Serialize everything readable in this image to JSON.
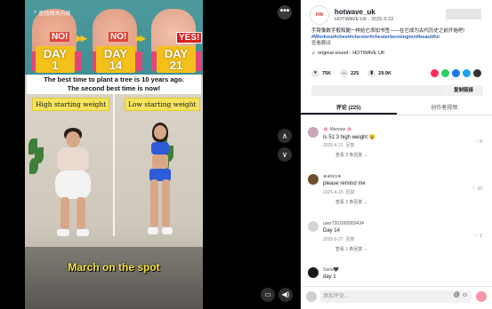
{
  "video": {
    "search_tag": "查找相关内容",
    "no_label": "NO!",
    "yes_label": "YES!",
    "days": [
      {
        "word": "DAY",
        "num": "1"
      },
      {
        "word": "DAY",
        "num": "14"
      },
      {
        "word": "DAY",
        "num": "21"
      }
    ],
    "quote_line1": "The best time to plant a tree is 10 years ago.",
    "quote_line2": "The second best time is now!",
    "label_left": "High starting weight",
    "label_right": "Low starting weight",
    "caption": "March on the spot"
  },
  "controls": {
    "more": "•••",
    "prev": "∧",
    "next": "∨"
  },
  "author": {
    "name": "hotwave_uk",
    "subtitle": "HOTWAVE UK · 2025-5-22",
    "desc": "手臂像数字般和腿一样给它添加书签——在它成为古代历史之前开始吧!",
    "tags": "#Workout#chest#chester#chesterbennington#beautiful",
    "translate": "查看翻译",
    "sound": "original sound - HOTWAVE UK"
  },
  "stats": {
    "likes": "75K",
    "comments": "225",
    "saves": "29.9K"
  },
  "share_colors": [
    "#fe2c55",
    "#25d366",
    "#1877f2",
    "#1da1f2",
    "#333333"
  ],
  "copy_link": "复制链接",
  "tabs": {
    "comments": "评论 (225)",
    "creator_videos": "创作者视频"
  },
  "comments": [
    {
      "user": "🌸 Marwee 🌸",
      "text": "Is 51.3 high weight 😮",
      "date": "2025-4-21",
      "reply": "回复",
      "more": "查看 3 条回复",
      "likes": "8",
      "avatar": "#c9a6b8"
    },
    {
      "user": "★alisry★",
      "text": "please remind me",
      "date": "2025-4-15",
      "reply": "回复",
      "more": "查看 2 条回复",
      "likes": "10",
      "avatar": "#6b4f2a"
    },
    {
      "user": "user7201669959434",
      "text": "Day 14",
      "date": "2025-5-27",
      "reply": "回复",
      "more": "查看 1 条回复",
      "likes": "1",
      "avatar": "#d4d4d4"
    },
    {
      "user": "Sana🖤",
      "text": "day 1",
      "date": "",
      "reply": "",
      "more": "",
      "likes": "",
      "avatar": "#1a1a1a"
    }
  ],
  "input": {
    "placeholder": "添加评论...",
    "icons": "@ ☺"
  }
}
